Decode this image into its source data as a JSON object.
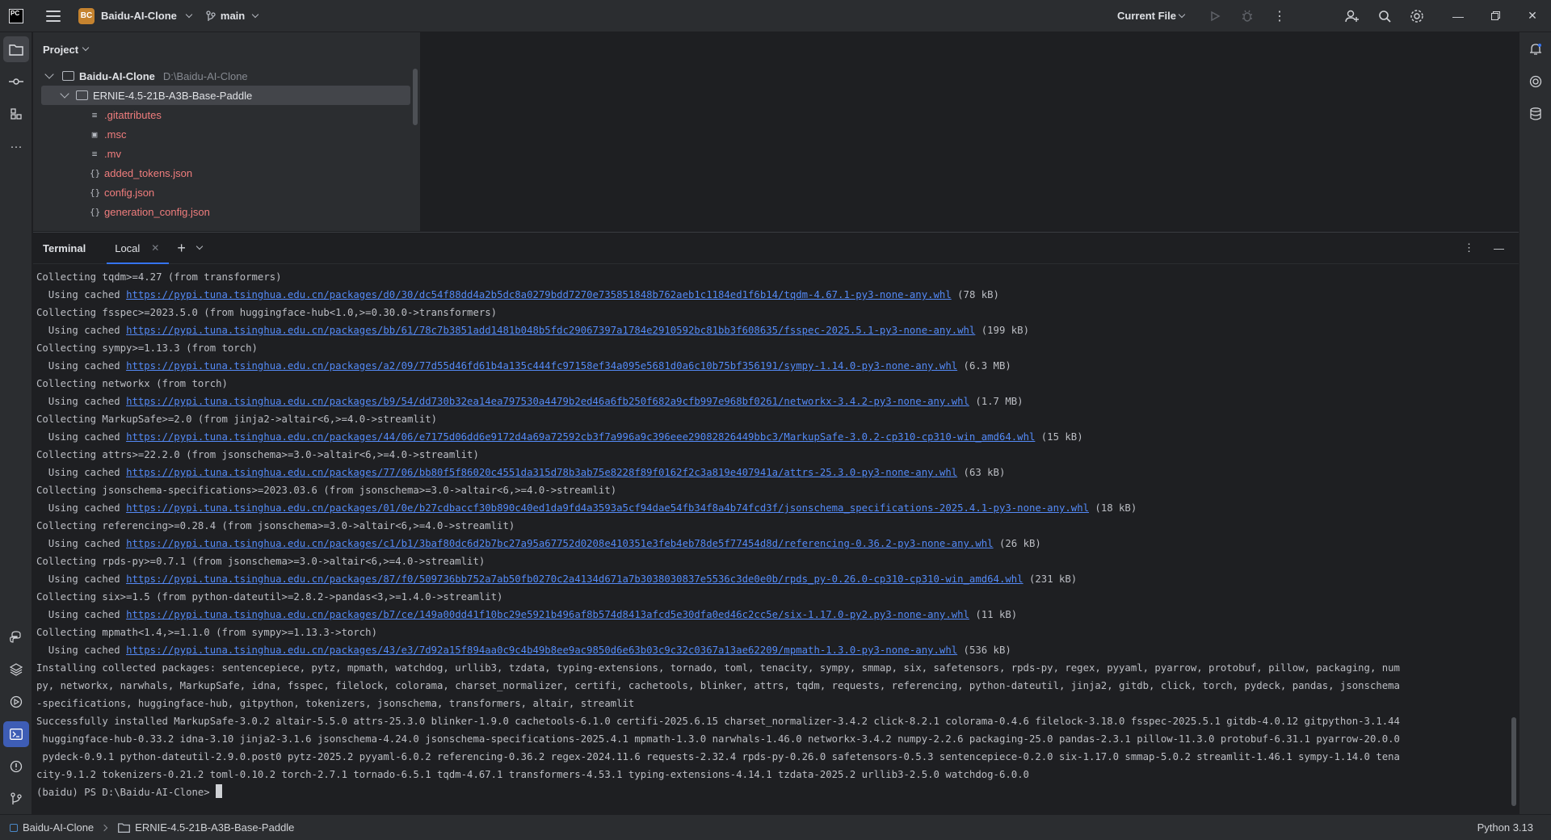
{
  "titlebar": {
    "project_badge": "BC",
    "project_name": "Baidu-AI-Clone",
    "branch": "main",
    "run_config": "Current File"
  },
  "project_panel": {
    "title": "Project",
    "tree": [
      {
        "name": "Baidu-AI-Clone",
        "path": "D:\\Baidu-AI-Clone"
      },
      {
        "name": "ERNIE-4.5-21B-A3B-Base-Paddle"
      },
      {
        "name": ".gitattributes",
        "icon": "lines-file-icon"
      },
      {
        "name": ".msc",
        "icon": "binary-file-icon"
      },
      {
        "name": ".mv",
        "icon": "lines-file-icon"
      },
      {
        "name": "added_tokens.json",
        "icon": "json-file-icon"
      },
      {
        "name": "config.json",
        "icon": "json-file-icon"
      },
      {
        "name": "generation_config.json",
        "icon": "json-file-icon"
      }
    ]
  },
  "terminal": {
    "title": "Terminal",
    "tab": "Local",
    "lines": [
      {
        "t": "Collecting tqdm>=4.27 (from transformers)"
      },
      {
        "pre": "  Using cached ",
        "url": "https://pypi.tuna.tsinghua.edu.cn/packages/d0/30/dc54f88dd4a2b5dc8a0279bdd7270e735851848b762aeb1c1184ed1f6b14/tqdm-4.67.1-py3-none-any.whl",
        "post": " (78 kB)"
      },
      {
        "t": "Collecting fsspec>=2023.5.0 (from huggingface-hub<1.0,>=0.30.0->transformers)"
      },
      {
        "pre": "  Using cached ",
        "url": "https://pypi.tuna.tsinghua.edu.cn/packages/bb/61/78c7b3851add1481b048b5fdc29067397a1784e2910592bc81bb3f608635/fsspec-2025.5.1-py3-none-any.whl",
        "post": " (199 kB)"
      },
      {
        "t": "Collecting sympy>=1.13.3 (from torch)"
      },
      {
        "pre": "  Using cached ",
        "url": "https://pypi.tuna.tsinghua.edu.cn/packages/a2/09/77d55d46fd61b4a135c444fc97158ef34a095e5681d0a6c10b75bf356191/sympy-1.14.0-py3-none-any.whl",
        "post": " (6.3 MB)"
      },
      {
        "t": "Collecting networkx (from torch)"
      },
      {
        "pre": "  Using cached ",
        "url": "https://pypi.tuna.tsinghua.edu.cn/packages/b9/54/dd730b32ea14ea797530a4479b2ed46a6fb250f682a9cfb997e968bf0261/networkx-3.4.2-py3-none-any.whl",
        "post": " (1.7 MB)"
      },
      {
        "t": "Collecting MarkupSafe>=2.0 (from jinja2->altair<6,>=4.0->streamlit)"
      },
      {
        "pre": "  Using cached ",
        "url": "https://pypi.tuna.tsinghua.edu.cn/packages/44/06/e7175d06dd6e9172d4a69a72592cb3f7a996a9c396eee29082826449bbc3/MarkupSafe-3.0.2-cp310-cp310-win_amd64.whl",
        "post": " (15 kB)"
      },
      {
        "t": "Collecting attrs>=22.2.0 (from jsonschema>=3.0->altair<6,>=4.0->streamlit)"
      },
      {
        "pre": "  Using cached ",
        "url": "https://pypi.tuna.tsinghua.edu.cn/packages/77/06/bb80f5f86020c4551da315d78b3ab75e8228f89f0162f2c3a819e407941a/attrs-25.3.0-py3-none-any.whl",
        "post": " (63 kB)"
      },
      {
        "t": "Collecting jsonschema-specifications>=2023.03.6 (from jsonschema>=3.0->altair<6,>=4.0->streamlit)"
      },
      {
        "pre": "  Using cached ",
        "url": "https://pypi.tuna.tsinghua.edu.cn/packages/01/0e/b27cdbaccf30b890c40ed1da9fd4a3593a5cf94dae54fb34f8a4b74fcd3f/jsonschema_specifications-2025.4.1-py3-none-any.whl",
        "post": " (18 kB)"
      },
      {
        "t": "Collecting referencing>=0.28.4 (from jsonschema>=3.0->altair<6,>=4.0->streamlit)"
      },
      {
        "pre": "  Using cached ",
        "url": "https://pypi.tuna.tsinghua.edu.cn/packages/c1/b1/3baf80dc6d2b7bc27a95a67752d0208e410351e3feb4eb78de5f77454d8d/referencing-0.36.2-py3-none-any.whl",
        "post": " (26 kB)"
      },
      {
        "t": "Collecting rpds-py>=0.7.1 (from jsonschema>=3.0->altair<6,>=4.0->streamlit)"
      },
      {
        "pre": "  Using cached ",
        "url": "https://pypi.tuna.tsinghua.edu.cn/packages/87/f0/509736bb752a7ab50fb0270c2a4134d671a7b3038030837e5536c3de0e0b/rpds_py-0.26.0-cp310-cp310-win_amd64.whl",
        "post": " (231 kB)"
      },
      {
        "t": "Collecting six>=1.5 (from python-dateutil>=2.8.2->pandas<3,>=1.4.0->streamlit)"
      },
      {
        "pre": "  Using cached ",
        "url": "https://pypi.tuna.tsinghua.edu.cn/packages/b7/ce/149a00dd41f10bc29e5921b496af8b574d8413afcd5e30dfa0ed46c2cc5e/six-1.17.0-py2.py3-none-any.whl",
        "post": " (11 kB)"
      },
      {
        "t": "Collecting mpmath<1.4,>=1.1.0 (from sympy>=1.13.3->torch)"
      },
      {
        "pre": "  Using cached ",
        "url": "https://pypi.tuna.tsinghua.edu.cn/packages/43/e3/7d92a15f894aa0c9c4b49b8ee9ac9850d6e63b03c9c32c0367a13ae62209/mpmath-1.3.0-py3-none-any.whl",
        "post": " (536 kB)"
      },
      {
        "t": "Installing collected packages: sentencepiece, pytz, mpmath, watchdog, urllib3, tzdata, typing-extensions, tornado, toml, tenacity, sympy, smmap, six, safetensors, rpds-py, regex, pyyaml, pyarrow, protobuf, pillow, packaging, num"
      },
      {
        "t": "py, networkx, narwhals, MarkupSafe, idna, fsspec, filelock, colorama, charset_normalizer, certifi, cachetools, blinker, attrs, tqdm, requests, referencing, python-dateutil, jinja2, gitdb, click, torch, pydeck, pandas, jsonschema"
      },
      {
        "t": "-specifications, huggingface-hub, gitpython, tokenizers, jsonschema, transformers, altair, streamlit"
      },
      {
        "t": "Successfully installed MarkupSafe-3.0.2 altair-5.5.0 attrs-25.3.0 blinker-1.9.0 cachetools-6.1.0 certifi-2025.6.15 charset_normalizer-3.4.2 click-8.2.1 colorama-0.4.6 filelock-3.18.0 fsspec-2025.5.1 gitdb-4.0.12 gitpython-3.1.44"
      },
      {
        "t": " huggingface-hub-0.33.2 idna-3.10 jinja2-3.1.6 jsonschema-4.24.0 jsonschema-specifications-2025.4.1 mpmath-1.3.0 narwhals-1.46.0 networkx-3.4.2 numpy-2.2.6 packaging-25.0 pandas-2.3.1 pillow-11.3.0 protobuf-6.31.1 pyarrow-20.0.0"
      },
      {
        "t": " pydeck-0.9.1 python-dateutil-2.9.0.post0 pytz-2025.2 pyyaml-6.0.2 referencing-0.36.2 regex-2024.11.6 requests-2.32.4 rpds-py-0.26.0 safetensors-0.5.3 sentencepiece-0.2.0 six-1.17.0 smmap-5.0.2 streamlit-1.46.1 sympy-1.14.0 tena"
      },
      {
        "t": "city-9.1.2 tokenizers-0.21.2 toml-0.10.2 torch-2.7.1 tornado-6.5.1 tqdm-4.67.1 transformers-4.53.1 typing-extensions-4.14.1 tzdata-2025.2 urllib3-2.5.0 watchdog-6.0.0"
      }
    ],
    "prompt": "(baidu) PS D:\\Baidu-AI-Clone> "
  },
  "statusbar": {
    "crumb_root": "Baidu-AI-Clone",
    "crumb_folder": "ERNIE-4.5-21B-A3B-Base-Paddle",
    "interpreter": "Python 3.13"
  }
}
